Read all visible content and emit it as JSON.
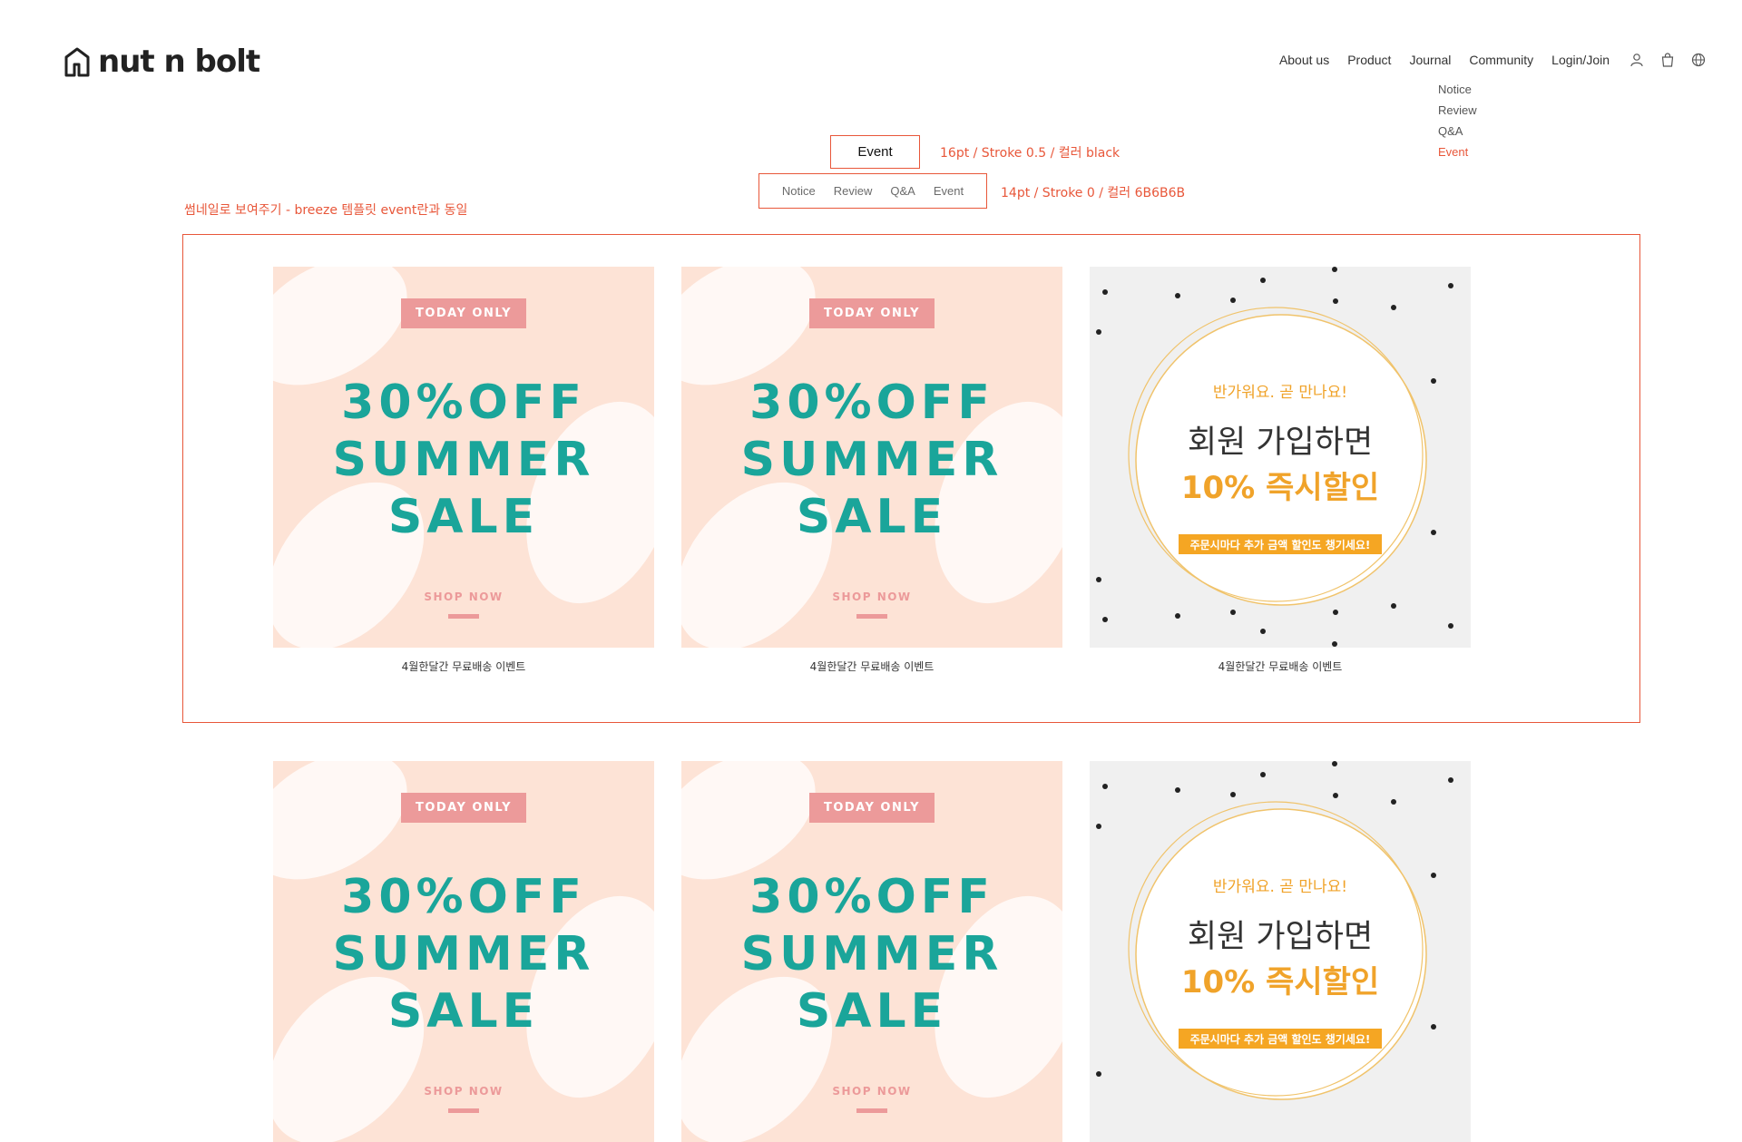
{
  "brand": {
    "name": "nut n bolt"
  },
  "nav": {
    "items": [
      {
        "id": "about",
        "label": "About us"
      },
      {
        "id": "product",
        "label": "Product"
      },
      {
        "id": "journal",
        "label": "Journal"
      },
      {
        "id": "community",
        "label": "Community"
      },
      {
        "id": "login",
        "label": "Login/Join"
      }
    ],
    "icons": [
      "user-icon",
      "bag-icon",
      "globe-icon"
    ]
  },
  "community_submenu": [
    {
      "label": "Notice",
      "active": false
    },
    {
      "label": "Review",
      "active": false
    },
    {
      "label": "Q&A",
      "active": false
    },
    {
      "label": "Event",
      "active": true
    }
  ],
  "page": {
    "title": "Event",
    "tabs": [
      "Notice",
      "Review",
      "Q&A",
      "Event"
    ]
  },
  "annotations": {
    "title_spec": "16pt / Stroke 0.5 / 컬러 black",
    "tabs_spec": "14pt / Stroke 0 / 컬러 6B6B6B",
    "thumbnail_note": "썸네일로 보여주기 - breeze 템플릿 event란과 동일"
  },
  "events": [
    {
      "type": "sale",
      "badge": "TODAY ONLY",
      "lines": [
        "30%OFF",
        "SUMMER",
        "SALE"
      ],
      "cta": "SHOP NOW",
      "caption": "4월한달간 무료배송 이벤트"
    },
    {
      "type": "sale",
      "badge": "TODAY ONLY",
      "lines": [
        "30%OFF",
        "SUMMER",
        "SALE"
      ],
      "cta": "SHOP NOW",
      "caption": "4월한달간 무료배송 이벤트"
    },
    {
      "type": "member",
      "line1": "반가워요. 곧 만나요!",
      "line2": "회원 가입하면",
      "line3": "10% 즉시할인",
      "line4": "주문시마다 추가 금액 할인도 챙기세요!",
      "caption": "4월한달간 무료배송 이벤트"
    },
    {
      "type": "sale",
      "badge": "TODAY ONLY",
      "lines": [
        "30%OFF",
        "SUMMER",
        "SALE"
      ],
      "cta": "SHOP NOW",
      "caption": ""
    },
    {
      "type": "sale",
      "badge": "TODAY ONLY",
      "lines": [
        "30%OFF",
        "SUMMER",
        "SALE"
      ],
      "cta": "SHOP NOW",
      "caption": ""
    },
    {
      "type": "member",
      "line1": "반가워요. 곧 만나요!",
      "line2": "회원 가입하면",
      "line3": "10% 즉시할인",
      "line4": "주문시마다 추가 금액 할인도 챙기세요!",
      "caption": ""
    }
  ],
  "colors": {
    "accent": "#e8573a",
    "tab_text": "#6B6B6B",
    "sale_teal": "#1aa59a",
    "sale_pink": "#ec9a9a",
    "sale_bg": "#fde3d6",
    "member_orange": "#f0a32a"
  }
}
